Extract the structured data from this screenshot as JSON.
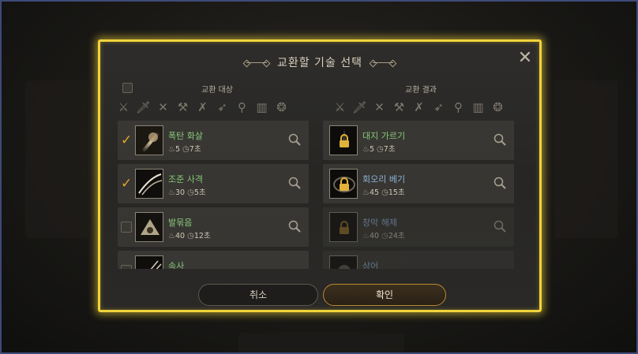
{
  "dialog": {
    "title": "교환할 기술 선택",
    "close_icon": "close-icon",
    "accent_color": "#f1d33b"
  },
  "left": {
    "header": "교환 대상",
    "filters": [
      "claws-icon",
      "sword-icon",
      "crossed-blades-icon",
      "axe-icon",
      "crossbow-icon",
      "bow-icon",
      "staff-icon",
      "book-icon",
      "orb-icon"
    ],
    "skills": [
      {
        "name": "폭탄 화살",
        "count": "5",
        "cooldown": "7초",
        "checked": true
      },
      {
        "name": "조준 사격",
        "count": "30",
        "cooldown": "5초",
        "checked": true
      },
      {
        "name": "발묶음",
        "count": "40",
        "cooldown": "12초",
        "checked": false
      },
      {
        "name": "속사",
        "count": "",
        "cooldown": "",
        "checked": false
      }
    ]
  },
  "right": {
    "header": "교환 결과",
    "filters": [
      "claws-icon",
      "sword-icon",
      "crossed-blades-icon",
      "axe-icon",
      "crossbow-icon",
      "bow-icon",
      "staff-icon",
      "book-icon",
      "orb-icon"
    ],
    "skills": [
      {
        "name": "대지 가르기",
        "count": "5",
        "cooldown": "7초"
      },
      {
        "name": "회오리 베기",
        "count": "45",
        "cooldown": "15초"
      },
      {
        "name": "창막 해제",
        "count": "40",
        "cooldown": "24초"
      },
      {
        "name": "상어",
        "count": "",
        "cooldown": ""
      }
    ]
  },
  "buttons": {
    "cancel": "취소",
    "confirm": "확인"
  }
}
